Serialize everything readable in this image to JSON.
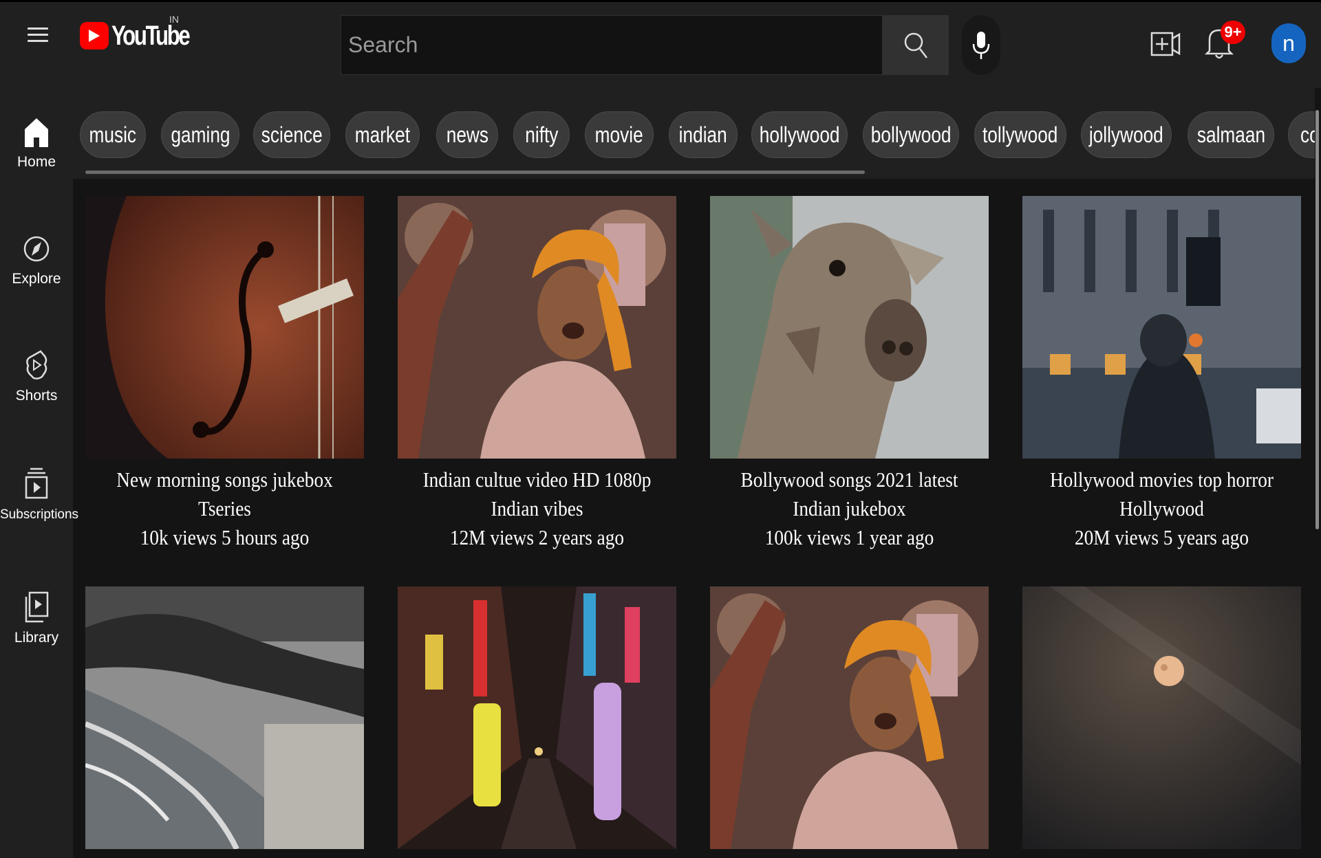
{
  "header": {
    "logo_text": "YouTube",
    "country": "IN",
    "search_placeholder": "Search",
    "notification_count": "9+",
    "avatar_letter": "n"
  },
  "sidebar": {
    "items": [
      {
        "label": "Home",
        "icon": "home-icon"
      },
      {
        "label": "Explore",
        "icon": "compass-icon"
      },
      {
        "label": "Shorts",
        "icon": "shorts-icon"
      },
      {
        "label": "Subscriptions",
        "icon": "subscriptions-icon"
      },
      {
        "label": "Library",
        "icon": "library-icon"
      }
    ]
  },
  "chips": [
    "music",
    "gaming",
    "science",
    "market",
    "news",
    "nifty",
    "movie",
    "indian",
    "hollywood",
    "bollywood",
    "tollywood",
    "jollywood",
    "salmaan",
    "co"
  ],
  "videos": [
    {
      "title": "New morning songs jukebox",
      "channel": "Tseries",
      "stats": "10k views 5 hours ago"
    },
    {
      "title": "Indian cultue video HD 1080p",
      "channel": "Indian vibes",
      "stats": "12M views 2 years ago"
    },
    {
      "title": "Bollywood songs 2021 latest",
      "channel": "Indian jukebox",
      "stats": "100k views 1 year ago"
    },
    {
      "title": "Hollywood movies top horror",
      "channel": "Hollywood",
      "stats": "20M views 5 years ago"
    }
  ],
  "colors": {
    "background": "#141414",
    "header": "#202020",
    "brand_red": "#ff0000",
    "avatar": "#1565c0",
    "chip": "#3a3a3a"
  }
}
